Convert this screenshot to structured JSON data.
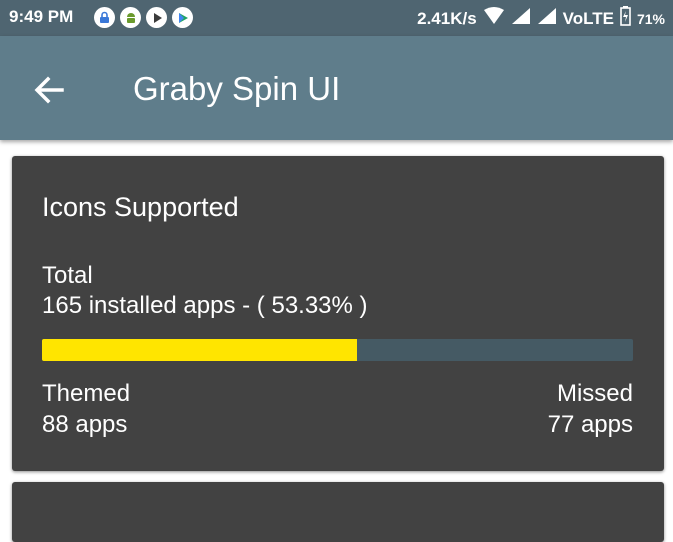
{
  "status_bar": {
    "time": "9:49 PM",
    "speed": "2.41K/s",
    "network": "VoLTE",
    "battery": "71%",
    "notification_icons": [
      "vpn-lock-icon",
      "android-icon",
      "play-icon",
      "play-store-icon"
    ]
  },
  "app_bar": {
    "title": "Graby Spin UI",
    "back_icon": "arrow-back-icon",
    "color": "#5f7d8b"
  },
  "icons_card": {
    "title": "Icons Supported",
    "total_label": "Total",
    "total_value": "165 installed apps - ( 53.33% )",
    "progress_fraction": 0.5333,
    "progress_color": "#ffe500",
    "track_color": "#455a64",
    "themed_label": "Themed",
    "themed_value": "88 apps",
    "missed_label": "Missed",
    "missed_value": "77 apps"
  }
}
